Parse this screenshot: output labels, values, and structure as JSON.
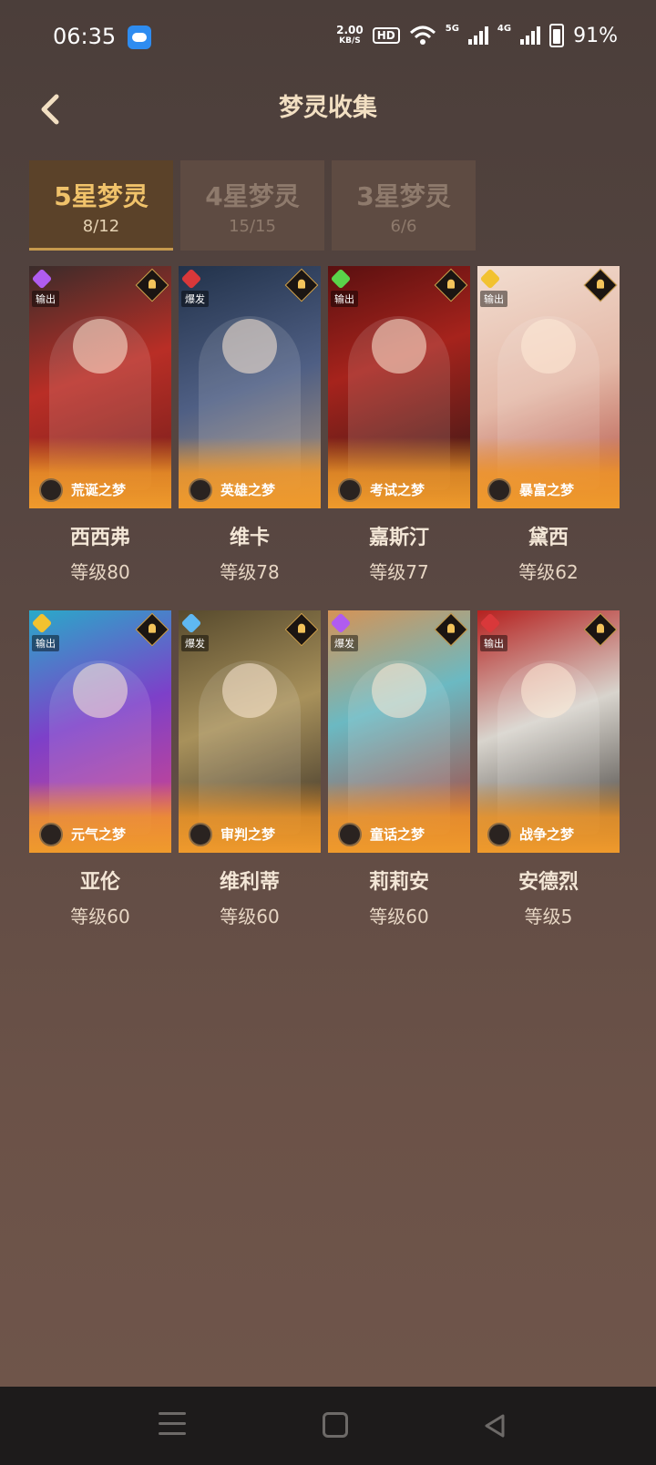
{
  "status_bar": {
    "time": "06:35",
    "net_speed_value": "2.00",
    "net_speed_unit": "KB/S",
    "hd": "HD",
    "net_5g": "5G",
    "net_4g": "4G",
    "battery": "91%"
  },
  "header": {
    "title": "梦灵收集"
  },
  "tabs": [
    {
      "name": "5星梦灵",
      "count": "8/12",
      "active": true
    },
    {
      "name": "4星梦灵",
      "count": "15/15",
      "active": false
    },
    {
      "name": "3星梦灵",
      "count": "6/6",
      "active": false
    }
  ],
  "cards": [
    {
      "role": "输出",
      "dream": "荒诞之梦",
      "name": "西西弗",
      "level": "等级80",
      "gem_color": "#b05cf0"
    },
    {
      "role": "爆发",
      "dream": "英雄之梦",
      "name": "维卡",
      "level": "等级78",
      "gem_color": "#d9383a"
    },
    {
      "role": "输出",
      "dream": "考试之梦",
      "name": "嘉斯汀",
      "level": "等级77",
      "gem_color": "#5ad34a"
    },
    {
      "role": "输出",
      "dream": "暴富之梦",
      "name": "黛西",
      "level": "等级62",
      "gem_color": "#f2c230"
    },
    {
      "role": "输出",
      "dream": "元气之梦",
      "name": "亚伦",
      "level": "等级60",
      "gem_color": "#f2c230"
    },
    {
      "role": "爆发",
      "dream": "审判之梦",
      "name": "维利蒂",
      "level": "等级60",
      "gem_color": "#5fb8f0"
    },
    {
      "role": "爆发",
      "dream": "童话之梦",
      "name": "莉莉安",
      "level": "等级60",
      "gem_color": "#b05cf0"
    },
    {
      "role": "输出",
      "dream": "战争之梦",
      "name": "安德烈",
      "level": "等级5",
      "gem_color": "#d9383a"
    }
  ]
}
